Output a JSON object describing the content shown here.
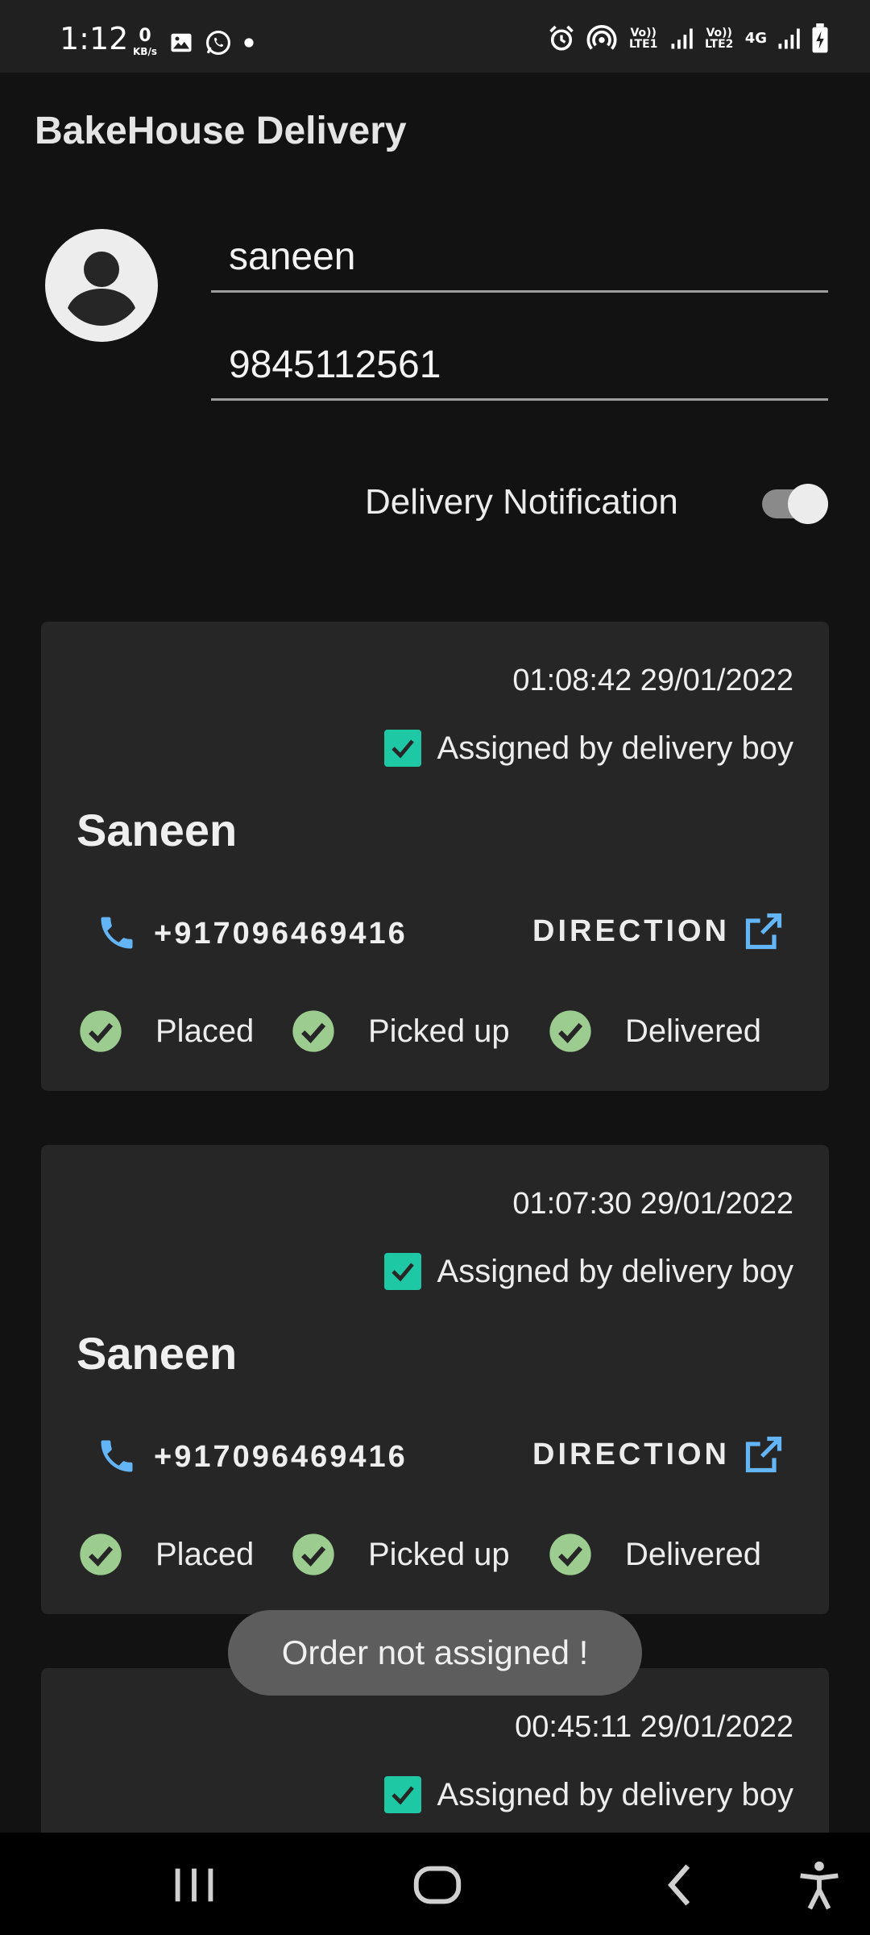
{
  "status_bar": {
    "time": "1:12",
    "data_speed_value": "0",
    "data_speed_unit": "KB/s",
    "sim1_label": "Vo)) LTE1",
    "sim2_label": "Vo)) LTE2",
    "network_type": "4G",
    "icons": [
      "image-icon",
      "whatsapp-icon",
      "dot-icon",
      "alarm-icon",
      "hotspot-icon",
      "signal-icon",
      "battery-charging-icon"
    ]
  },
  "app": {
    "title": "BakeHouse Delivery"
  },
  "profile": {
    "name_value": "saneen",
    "phone_value": "9845112561",
    "avatar_icon": "account-circle-icon"
  },
  "notification": {
    "label": "Delivery Notification",
    "enabled": true
  },
  "orders": [
    {
      "timestamp": "01:08:42 29/01/2022",
      "assigned_label": "Assigned by delivery boy",
      "assigned_checked": true,
      "customer_name": "Saneen",
      "phone": "+917096469416",
      "direction_label": "DIRECTION",
      "steps": [
        "Placed",
        "Picked up",
        "Delivered"
      ]
    },
    {
      "timestamp": "01:07:30 29/01/2022",
      "assigned_label": "Assigned by delivery boy",
      "assigned_checked": true,
      "customer_name": "Saneen",
      "phone": "+917096469416",
      "direction_label": "DIRECTION",
      "steps": [
        "Placed",
        "Picked up",
        "Delivered"
      ]
    },
    {
      "timestamp": "00:45:11 29/01/2022",
      "assigned_label": "Assigned by delivery boy",
      "assigned_checked": true
    }
  ],
  "toast": {
    "message": "Order not assigned !"
  },
  "colors": {
    "background": "#121212",
    "card": "#262626",
    "checkbox": "#1ec8a5",
    "step_check": "#9ccc8f",
    "accent_blue": "#64b5f6"
  },
  "nav": {
    "icons": [
      "recent-apps-icon",
      "home-icon",
      "back-icon",
      "accessibility-icon"
    ]
  }
}
